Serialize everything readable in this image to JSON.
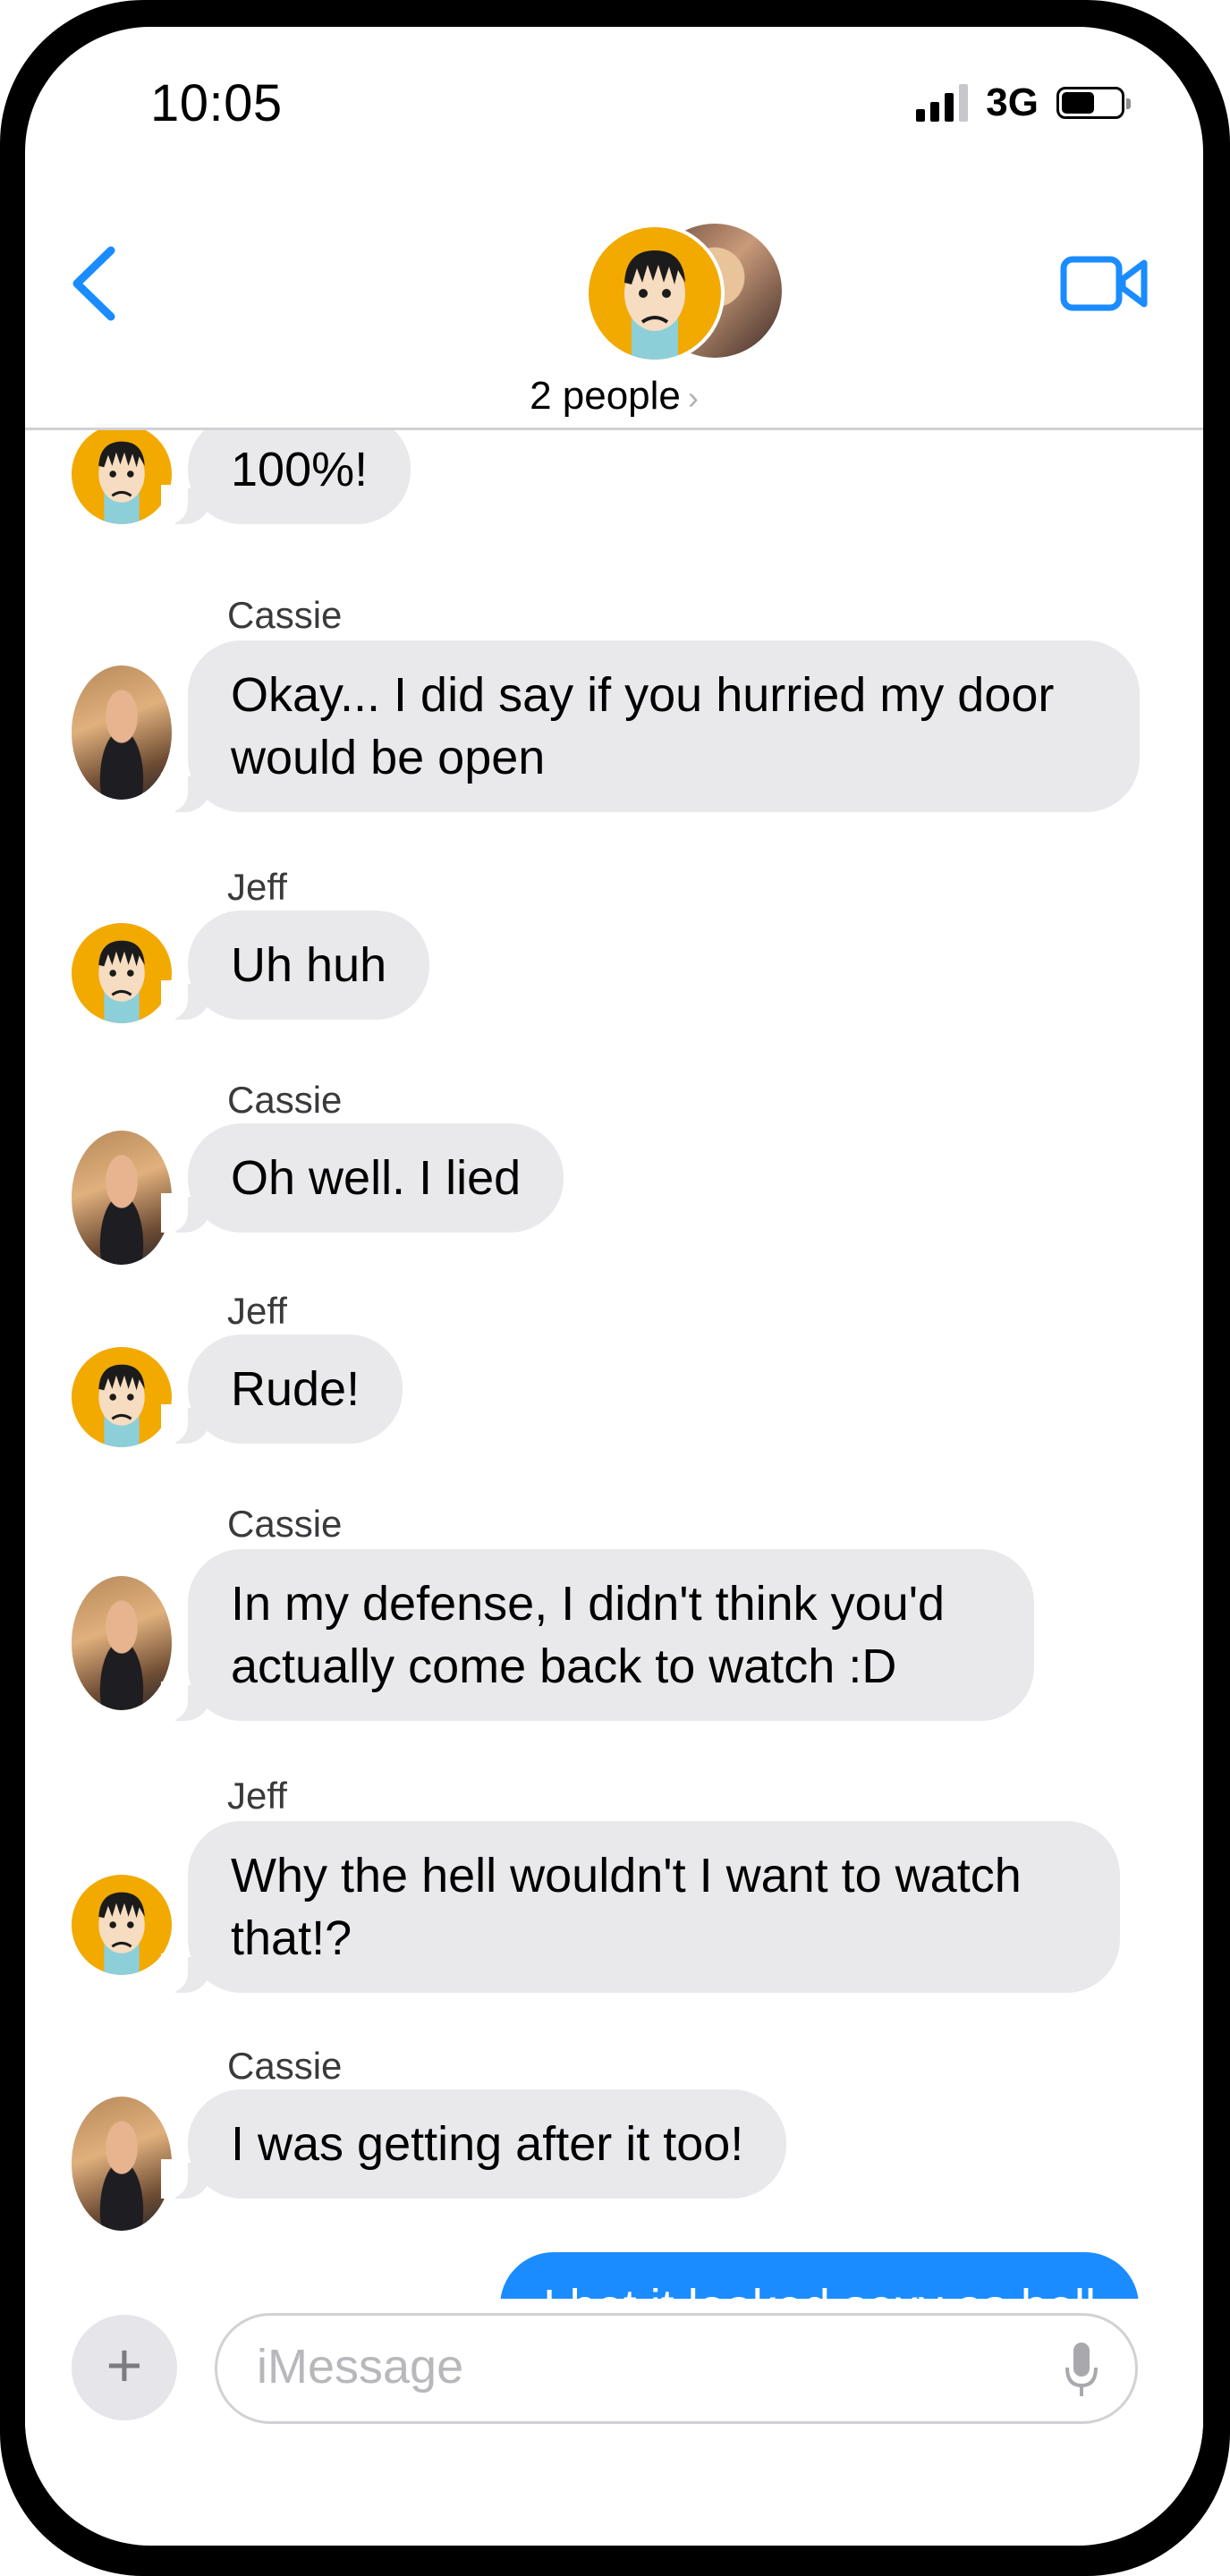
{
  "status_bar": {
    "time": "10:05",
    "network": "3G"
  },
  "header": {
    "people_label": "2 people",
    "chevron": "›"
  },
  "messages": [
    {
      "sender": "",
      "text": "100%!"
    },
    {
      "sender": "Cassie",
      "text": "Okay... I did say if you hurried my door would be open"
    },
    {
      "sender": "Jeff",
      "text": "Uh huh"
    },
    {
      "sender": "Cassie",
      "text": "Oh well.  I lied"
    },
    {
      "sender": "Jeff",
      "text": "Rude!"
    },
    {
      "sender": "Cassie",
      "text": "In my defense, I didn't think you'd actually come back to watch :D"
    },
    {
      "sender": "Jeff",
      "text": "Why the hell wouldn't I want to watch that!?"
    },
    {
      "sender": "Cassie",
      "text": "I was getting after it too!"
    },
    {
      "sender": "",
      "text": "I bet it looked sexy as hell"
    }
  ],
  "composer": {
    "plus": "+",
    "placeholder": "iMessage"
  },
  "icons": {
    "back": "chevron-left-icon",
    "video": "video-camera-icon",
    "mic": "microphone-icon",
    "plus": "plus-icon"
  },
  "colors": {
    "accent": "#1a8cff",
    "incoming_bubble": "#e9e9eb",
    "jeff_avatar": "#f2a900"
  }
}
